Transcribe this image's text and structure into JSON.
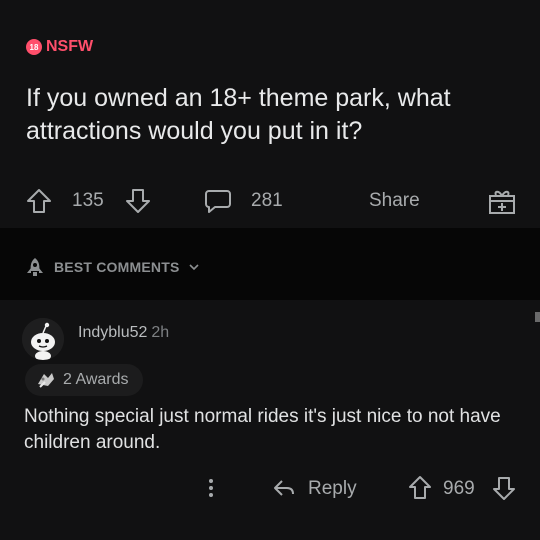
{
  "post": {
    "nsfw_label": "NSFW",
    "nsfw_badge": "18",
    "title": "If you owned an 18+ theme park, what attractions would you put in it?",
    "upvotes": "135",
    "comments": "281",
    "share_label": "Share"
  },
  "sort": {
    "label": "BEST COMMENTS"
  },
  "comment": {
    "author": "Indyblu52",
    "age": "2h",
    "awards": "2 Awards",
    "body": "Nothing special just normal rides it's just nice to not have children around.",
    "reply_label": "Reply",
    "score": "969"
  },
  "colors": {
    "nsfw": "#ff4f6b",
    "background": "#111112",
    "text": "#d7dadc"
  }
}
